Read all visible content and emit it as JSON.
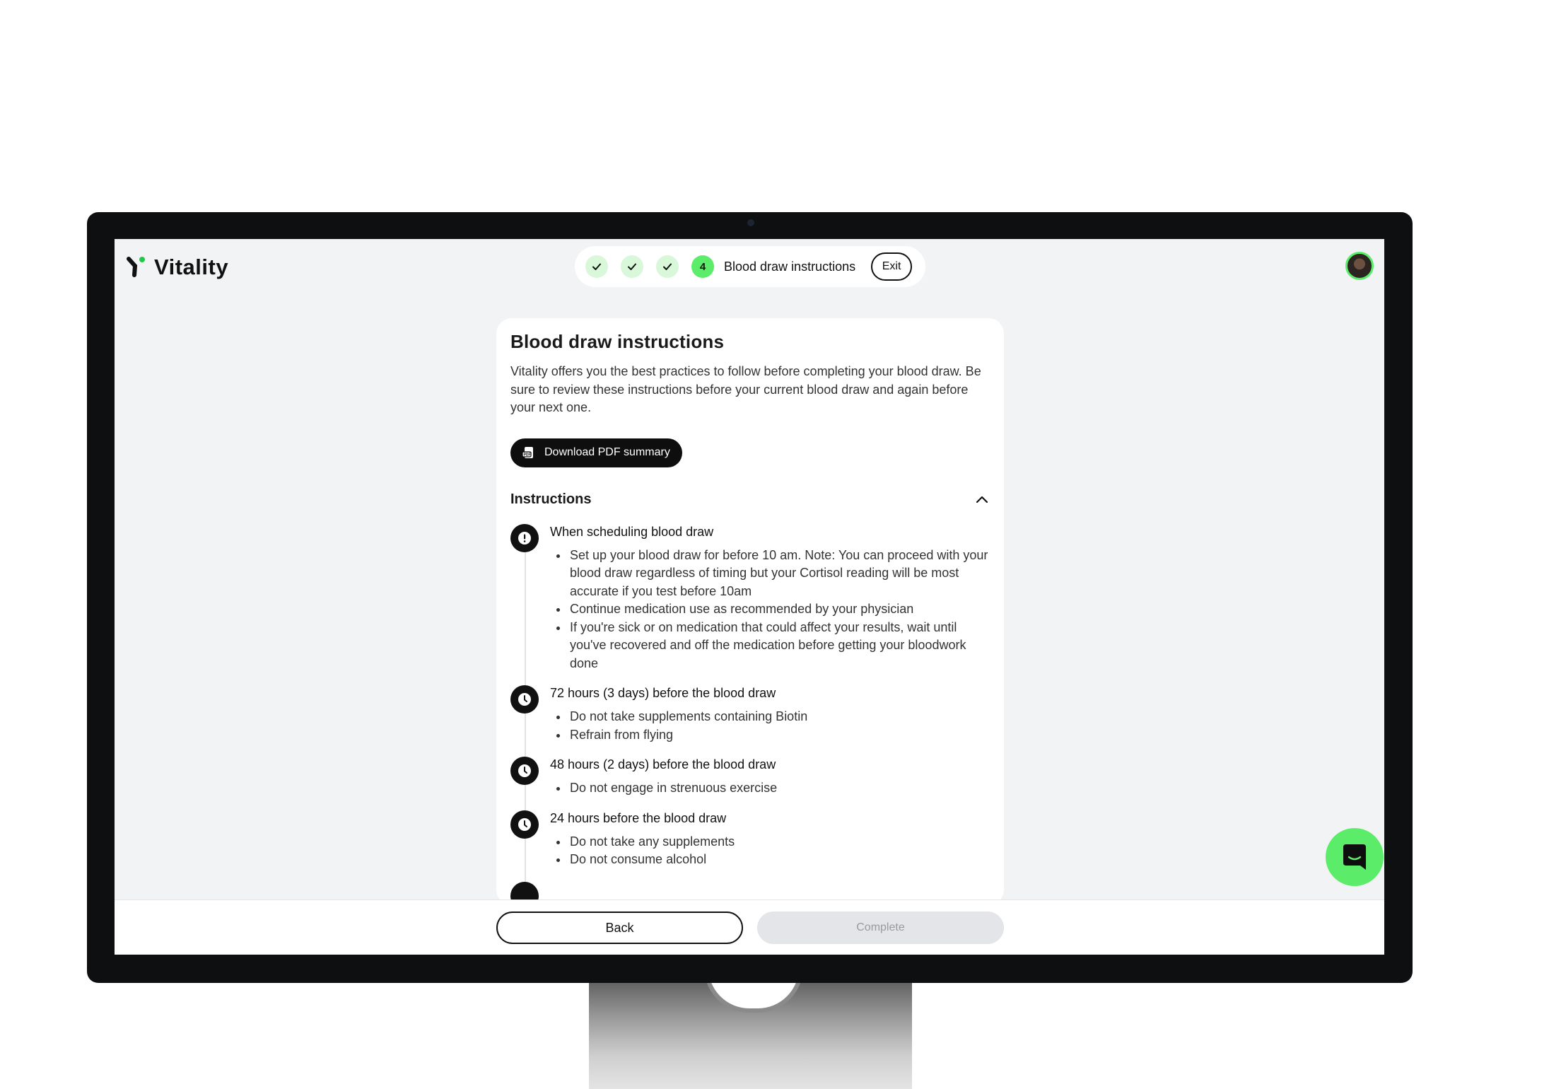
{
  "brand": {
    "name": "Vitality",
    "accent": "#5bec6a"
  },
  "stepper": {
    "completed_steps": 3,
    "current_step_number": "4",
    "current_step_label": "Blood draw instructions",
    "exit_label": "Exit"
  },
  "card": {
    "title": "Blood draw instructions",
    "intro": "Vitality offers you the best practices to follow before completing your blood draw. Be sure to review these instructions before your current blood draw and again before your next one.",
    "download_label": "Download PDF summary",
    "instructions_heading": "Instructions",
    "sections": [
      {
        "icon": "alert-icon",
        "title": "When scheduling blood draw",
        "items": [
          "Set up your blood draw for before 10 am. Note: You can proceed with your blood draw regardless of timing but your Cortisol reading will be most accurate if you test before 10am",
          "Continue medication use as recommended by your physician",
          "If you're sick or on medication that could affect your results, wait until you've recovered and off the medication before getting your bloodwork done"
        ]
      },
      {
        "icon": "clock-icon",
        "title": "72 hours (3 days) before the blood draw",
        "items": [
          "Do not take supplements containing Biotin",
          "Refrain from flying"
        ]
      },
      {
        "icon": "clock-icon",
        "title": "48 hours (2 days) before the blood draw",
        "items": [
          "Do not engage in strenuous exercise"
        ]
      },
      {
        "icon": "clock-icon",
        "title": "24 hours before the blood draw",
        "items": [
          "Do not take any supplements",
          "Do not consume alcohol"
        ]
      }
    ]
  },
  "footer": {
    "back_label": "Back",
    "complete_label": "Complete"
  },
  "chat": {
    "icon": "chat-icon"
  }
}
